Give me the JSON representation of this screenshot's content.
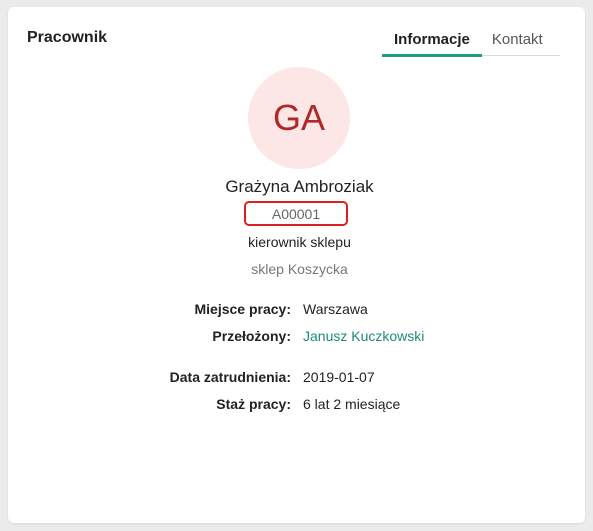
{
  "card": {
    "title": "Pracownik"
  },
  "tabs": [
    {
      "label": "Informacje",
      "active": true
    },
    {
      "label": "Kontakt",
      "active": false
    }
  ],
  "colors": {
    "accent": "#1f9b86",
    "link": "#1f8a78",
    "avatar_bg": "#fce6e6",
    "avatar_text": "#b22828",
    "highlight_border": "#e02020"
  },
  "employee": {
    "initials": "GA",
    "name": "Grażyna Ambroziak",
    "code": "A00001",
    "position": "kierownik sklepu",
    "store": "sklep Koszycka"
  },
  "details": {
    "workplace_label": "Miejsce pracy:",
    "workplace_value": "Warszawa",
    "supervisor_label": "Przełożony:",
    "supervisor_value": "Janusz Kuczkowski",
    "hire_date_label": "Data zatrudnienia:",
    "hire_date_value": "2019-01-07",
    "tenure_label": "Staż pracy:",
    "tenure_value": "6 lat 2 miesiące"
  }
}
